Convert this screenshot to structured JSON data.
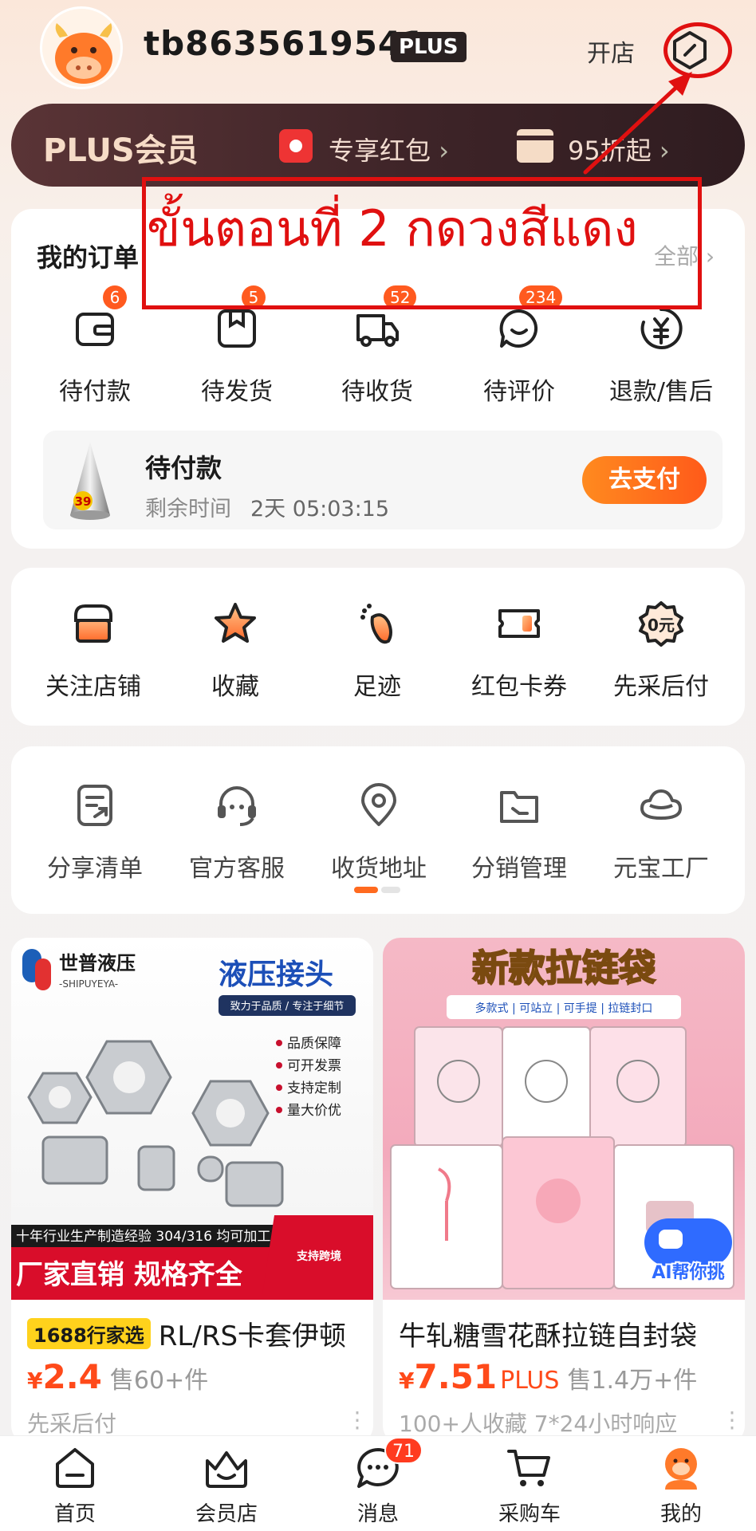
{
  "header": {
    "username": "tb8635619541",
    "plus_badge": "PLUS",
    "open_store": "开店",
    "avatar_icon": "cow-mascot-avatar",
    "settings_icon": "settings-hexagon-icon"
  },
  "plus_bar": {
    "title": "PLUS会员",
    "redpack_label": "专享红包",
    "discount_label": "95折起",
    "chevron": "›"
  },
  "annotation": {
    "text": "ขั้นตอนที่ 2 กดวงสีแดง",
    "color": "#e01010"
  },
  "orders": {
    "title": "我的订单",
    "all_label": "全部",
    "items": [
      {
        "label": "待付款",
        "badge": "6",
        "icon": "wallet-icon"
      },
      {
        "label": "待发货",
        "badge": "5",
        "icon": "package-icon"
      },
      {
        "label": "待收货",
        "badge": "52",
        "icon": "truck-icon"
      },
      {
        "label": "待评价",
        "badge": "234",
        "icon": "chat-smile-icon"
      },
      {
        "label": "退款/售后",
        "badge": "",
        "icon": "refund-yen-icon"
      }
    ],
    "pending": {
      "title": "待付款",
      "time_label": "剩余时间",
      "time_value": "2天 05:03:15",
      "thumb_number": "39",
      "button": "去支付"
    }
  },
  "shortcuts": [
    {
      "label": "关注店铺",
      "icon": "store-icon"
    },
    {
      "label": "收藏",
      "icon": "star-icon"
    },
    {
      "label": "足迹",
      "icon": "footprint-icon"
    },
    {
      "label": "红包卡券",
      "icon": "coupon-icon"
    },
    {
      "label": "先采后付",
      "icon": "badge-zero-yuan-icon",
      "icon_text": "0元"
    }
  ],
  "tools": [
    {
      "label": "分享清单",
      "icon": "share-list-icon"
    },
    {
      "label": "官方客服",
      "icon": "headset-icon"
    },
    {
      "label": "收货地址",
      "icon": "location-pin-icon"
    },
    {
      "label": "分销管理",
      "icon": "folder-icon"
    },
    {
      "label": "元宝工厂",
      "icon": "ingot-icon"
    }
  ],
  "products": [
    {
      "tag": "1688行家选",
      "title": "RL/RS卡套伊顿",
      "yen": "¥",
      "price": "2.4",
      "plus": "",
      "sold": "售60+件",
      "sub": "先采后付",
      "img": {
        "brand": "世普液压",
        "brand_en": "-SHIPUYEYA-",
        "headline": "液压接头",
        "slogan": "致力于品质 / 专注于细节",
        "bullets": [
          "品质保障",
          "可开发票",
          "支持定制",
          "量大价优"
        ],
        "footer_line": "十年行业生产制造经验 304/316 均可加工",
        "footer_big": "厂家直销 规格齐全",
        "corner_text": "支持跨境"
      }
    },
    {
      "tag": "",
      "title": "牛轧糖雪花酥拉链自封袋",
      "yen": "¥",
      "price": "7.51",
      "plus": "PLUS",
      "sold": "售1.4万+件",
      "sub": "100+人收藏  7*24小时响应",
      "img": {
        "headline": "新款拉链袋",
        "features": "多款式 | 可站立 | 可手提 | 拉链封口",
        "ai_label": "AI帮你挑"
      }
    }
  ],
  "tabbar": [
    {
      "label": "首页",
      "icon": "home-icon",
      "badge": ""
    },
    {
      "label": "会员店",
      "icon": "member-store-icon",
      "badge": ""
    },
    {
      "label": "消息",
      "icon": "message-icon",
      "badge": "71"
    },
    {
      "label": "采购车",
      "icon": "cart-icon",
      "badge": ""
    },
    {
      "label": "我的",
      "icon": "profile-mascot-icon",
      "badge": ""
    }
  ],
  "colors": {
    "accent": "#ff5a1f",
    "price": "#ff4a1a",
    "plus_bar": "#3e2428",
    "annotation": "#e01010"
  }
}
